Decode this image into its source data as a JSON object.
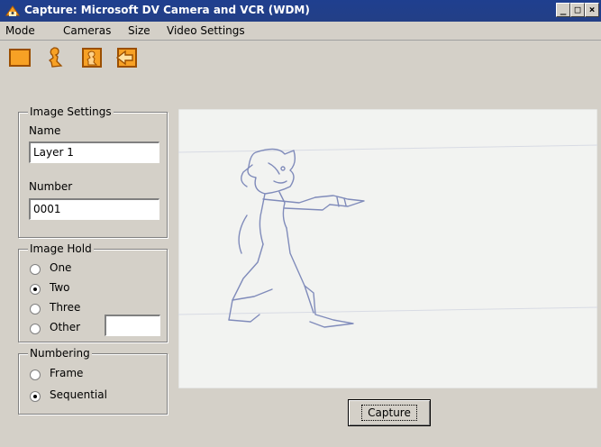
{
  "window": {
    "title": "Capture: Microsoft DV Camera and VCR (WDM)",
    "buttons": [
      "_",
      "□",
      "×"
    ]
  },
  "menu": [
    "Mode",
    "Cameras",
    "Size",
    "Video Settings"
  ],
  "toolbar": {
    "icons": [
      "frame-icon",
      "character-icon",
      "character-frame-icon",
      "import-arrow-icon"
    ]
  },
  "image_settings": {
    "legend": "Image Settings",
    "name_label": "Name",
    "name_value": "Layer 1",
    "number_label": "Number",
    "number_value": "0001"
  },
  "image_hold": {
    "legend": "Image Hold",
    "options": [
      "One",
      "Two",
      "Three",
      "Other"
    ],
    "selected": "Two"
  },
  "numbering": {
    "legend": "Numbering",
    "options": [
      "Frame",
      "Sequential"
    ],
    "selected": "Sequential"
  },
  "capture_button": "Capture",
  "colors": {
    "titlebar": "#1f3f8f",
    "toolbar_icon": "#f29a1f",
    "panel": "#d4d0c8"
  }
}
